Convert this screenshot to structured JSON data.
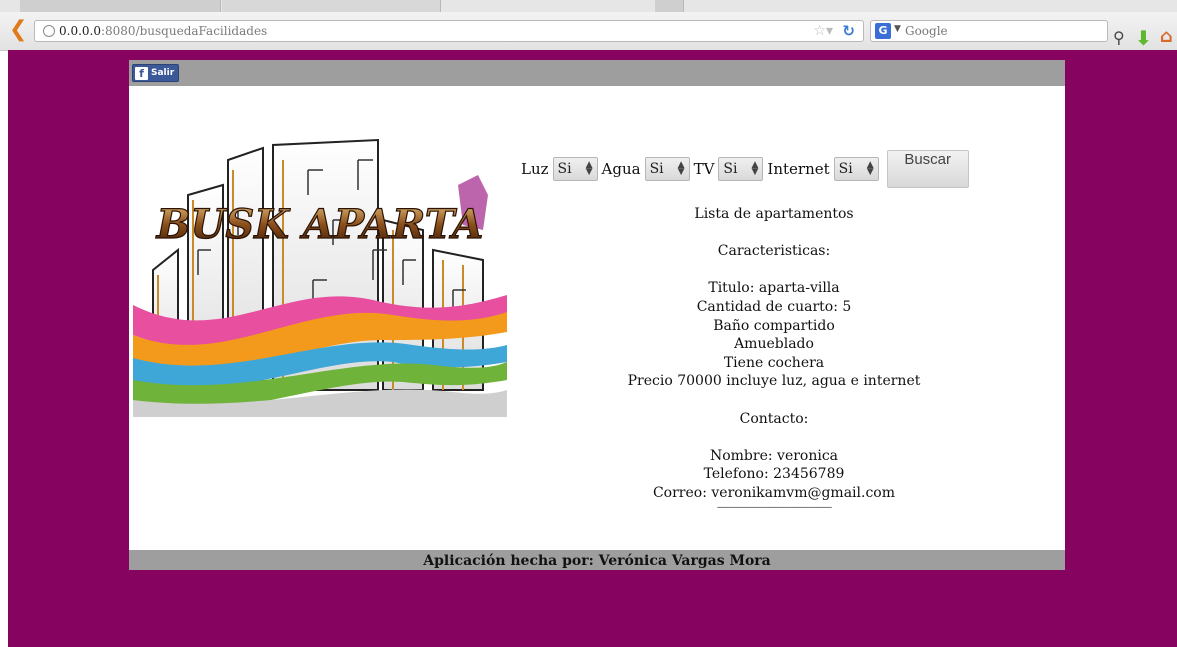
{
  "browser": {
    "url_host": "0.0.0.0",
    "url_rest": ":8080/busquedaFacilidades",
    "search_engine_label": "Google",
    "search_engine_icon": "G"
  },
  "topbar": {
    "fb_button_label": "Salir",
    "fb_icon": "f"
  },
  "logo": {
    "text": "BUSK APARTA"
  },
  "filters": {
    "luz_label": "Luz",
    "luz_value": "Si",
    "agua_label": "Agua",
    "agua_value": "Si",
    "tv_label": "TV",
    "tv_value": "Si",
    "internet_label": "Internet",
    "internet_value": "Si",
    "search_button": "Buscar"
  },
  "listing": {
    "heading": "Lista de apartamentos",
    "features_heading": "Caracteristicas:",
    "titulo": "Titulo: aparta-villa",
    "cuartos": "Cantidad de cuarto: 5",
    "bano": "Baño compartido",
    "amueblado": "Amueblado",
    "cochera": "Tiene cochera",
    "precio": "Precio 70000 incluye luz, agua e internet",
    "contact_heading": "Contacto:",
    "nombre": "Nombre: veronica",
    "telefono": "Telefono: 23456789",
    "correo": "Correo: veronikamvm@gmail.com",
    "separator": "--------------------------------------------------------"
  },
  "footer": {
    "text": "Aplicación hecha por: Verónica Vargas Mora"
  },
  "colors": {
    "page_background": "#86045f",
    "bar_gray": "#9e9e9e",
    "facebook_blue": "#3b5998"
  }
}
